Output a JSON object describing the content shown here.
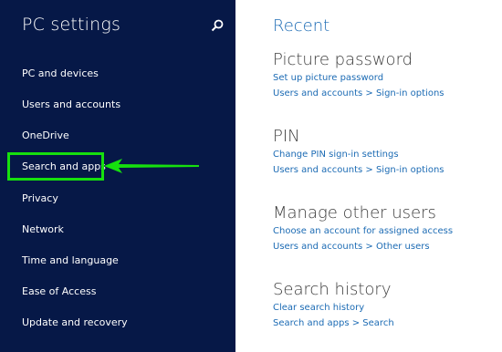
{
  "sidebar": {
    "title": "PC settings",
    "items": [
      {
        "label": "PC and devices"
      },
      {
        "label": "Users and accounts"
      },
      {
        "label": "OneDrive"
      },
      {
        "label": "Search and apps"
      },
      {
        "label": "Privacy"
      },
      {
        "label": "Network"
      },
      {
        "label": "Time and language"
      },
      {
        "label": "Ease of Access"
      },
      {
        "label": "Update and recovery"
      }
    ],
    "background_color": "#061847",
    "highlight_color": "#16e00e"
  },
  "main": {
    "heading": "Recent",
    "sections": [
      {
        "title": "Picture password",
        "links": [
          "Set up picture password",
          "Users and accounts > Sign-in options"
        ]
      },
      {
        "title": "PIN",
        "links": [
          "Change PIN sign-in settings",
          "Users and accounts > Sign-in options"
        ]
      },
      {
        "title": "Manage other users",
        "links": [
          "Choose an account for assigned access",
          "Users and accounts > Other users"
        ]
      },
      {
        "title": "Search history",
        "links": [
          "Clear search history",
          "Search and apps > Search"
        ]
      }
    ],
    "accent_color": "#1c6bb4"
  },
  "icons": {
    "search": "search-icon",
    "annotation_arrow": "arrow-left-icon"
  }
}
